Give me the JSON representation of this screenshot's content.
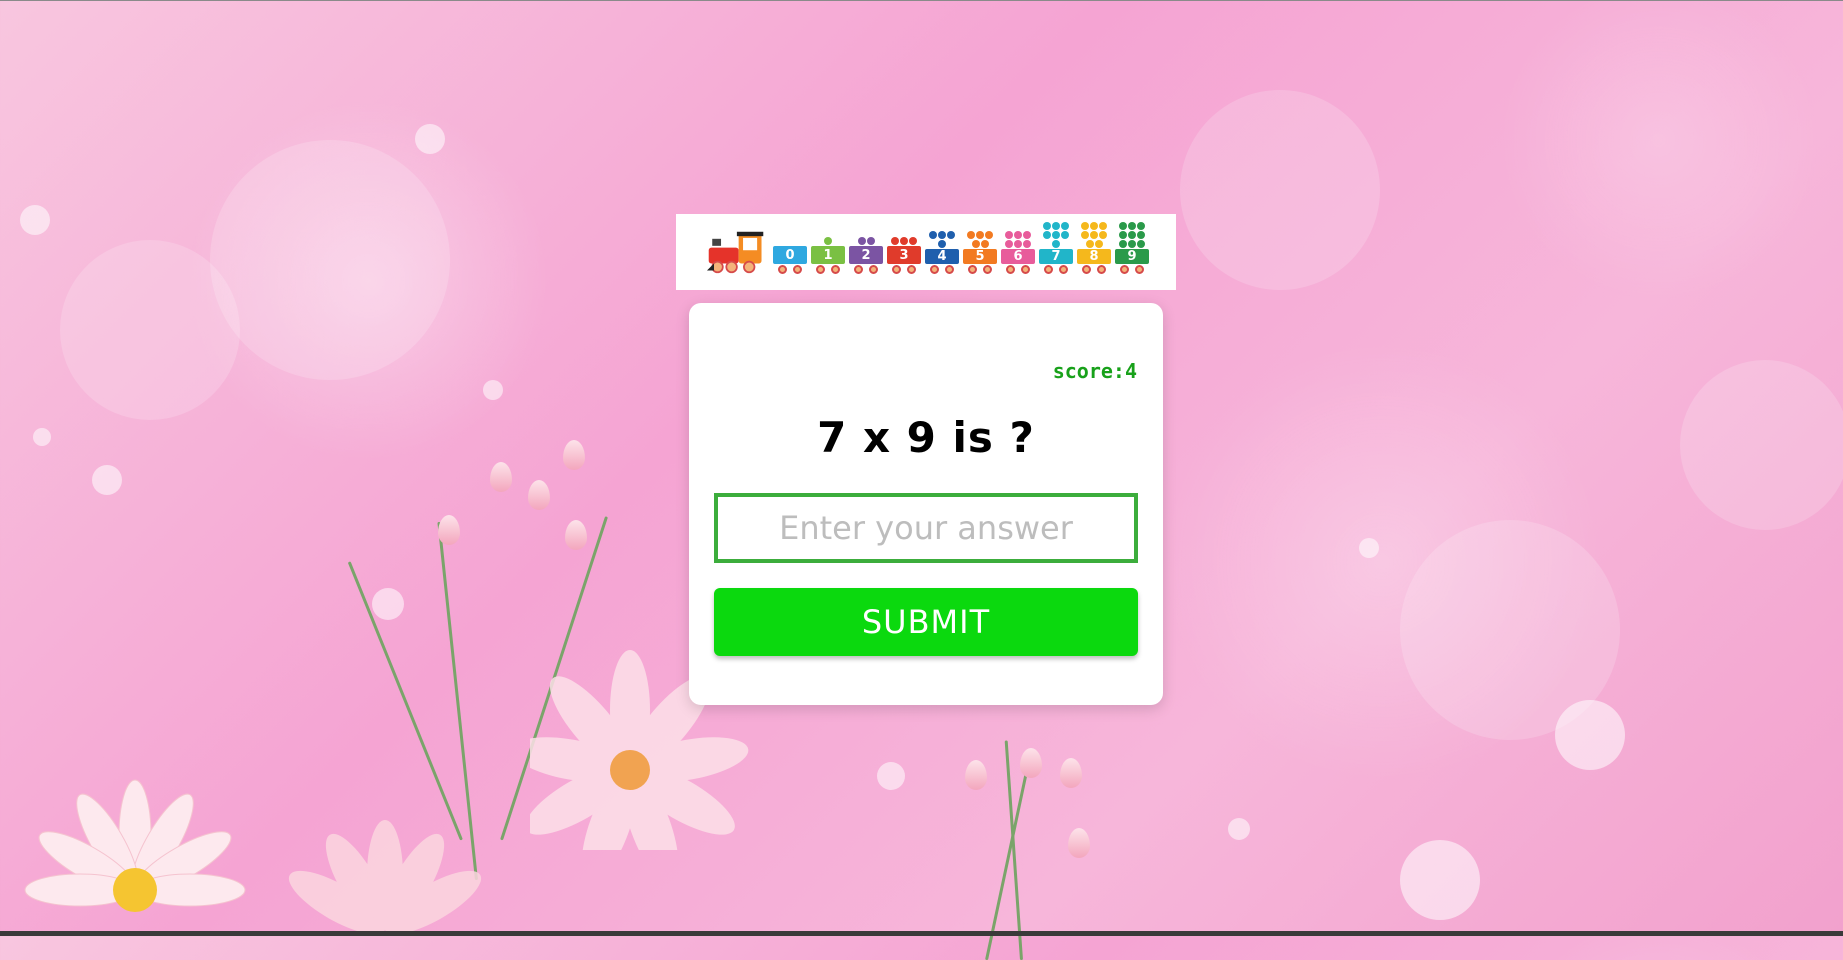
{
  "banner": {
    "wagon_numbers": [
      "0",
      "1",
      "2",
      "3",
      "4",
      "5",
      "6",
      "7",
      "8",
      "9"
    ],
    "wagon_colors": [
      "#2fa8e0",
      "#7ac043",
      "#7b54a3",
      "#e03b2b",
      "#1f5fad",
      "#f27a21",
      "#e85c9b",
      "#21b5c9",
      "#f5b81c",
      "#2a9a4a"
    ]
  },
  "quiz": {
    "score_label": "score:4",
    "question": "7 x 9 is ?",
    "answer_placeholder": "Enter your answer",
    "answer_value": "",
    "submit_label": "SUBMIT"
  },
  "colors": {
    "accent_green": "#0bd90e",
    "score_green": "#18a11a",
    "input_border": "#3cad3c"
  }
}
